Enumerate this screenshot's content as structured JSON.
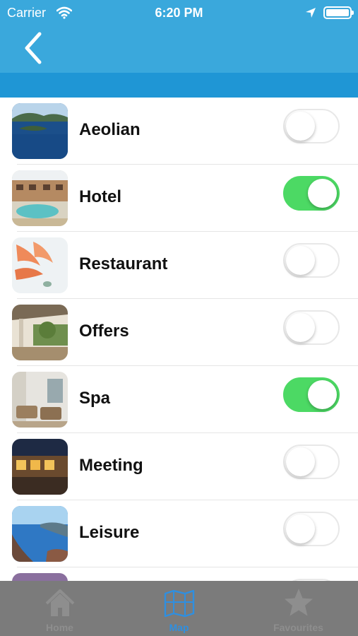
{
  "status": {
    "carrier": "Carrier",
    "time": "6:20 PM"
  },
  "list": {
    "items": [
      {
        "label": "Aeolian",
        "enabled": false
      },
      {
        "label": "Hotel",
        "enabled": true
      },
      {
        "label": "Restaurant",
        "enabled": false
      },
      {
        "label": "Offers",
        "enabled": false
      },
      {
        "label": "Spa",
        "enabled": true
      },
      {
        "label": "Meeting",
        "enabled": false
      },
      {
        "label": "Leisure",
        "enabled": false
      },
      {
        "label": "",
        "enabled": false
      }
    ]
  },
  "tabbar": {
    "tabs": [
      {
        "label": "Home",
        "icon": "home-icon"
      },
      {
        "label": "Map",
        "icon": "map-icon",
        "active": true
      },
      {
        "label": "Favourites",
        "icon": "star-icon"
      }
    ]
  },
  "colors": {
    "nav": "#3aa8dc",
    "subbar": "#1f96d5",
    "toggle_on": "#4cd964",
    "tab_active": "#2f8fe0",
    "tabbar": "#7b7b7b"
  }
}
